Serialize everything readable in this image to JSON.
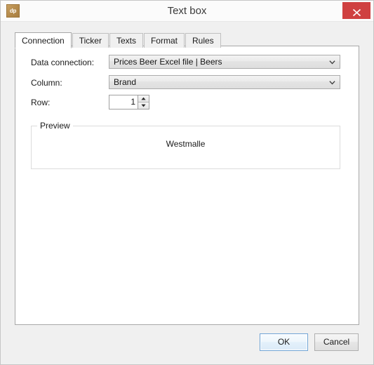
{
  "window": {
    "title": "Text box",
    "app_icon_label": "dp",
    "close_label": "×"
  },
  "tabs": [
    {
      "label": "Connection",
      "active": true
    },
    {
      "label": "Ticker",
      "active": false
    },
    {
      "label": "Texts",
      "active": false
    },
    {
      "label": "Format",
      "active": false
    },
    {
      "label": "Rules",
      "active": false
    }
  ],
  "connection_tab": {
    "data_connection": {
      "label": "Data connection:",
      "value": "Prices Beer Excel file | Beers"
    },
    "column": {
      "label": "Column:",
      "value": "Brand"
    },
    "row": {
      "label": "Row:",
      "value": "1"
    },
    "preview": {
      "title": "Preview",
      "text": "Westmalle"
    }
  },
  "footer": {
    "ok_label": "OK",
    "cancel_label": "Cancel"
  },
  "colors": {
    "titlebar": "#fbfbfb",
    "dialog_bg": "#f0f0f0",
    "panel_bg": "#ffffff",
    "close_red": "#cf4040",
    "app_icon_brown": "#b58b4c",
    "ok_focus_blue": "#6fa4d6"
  }
}
